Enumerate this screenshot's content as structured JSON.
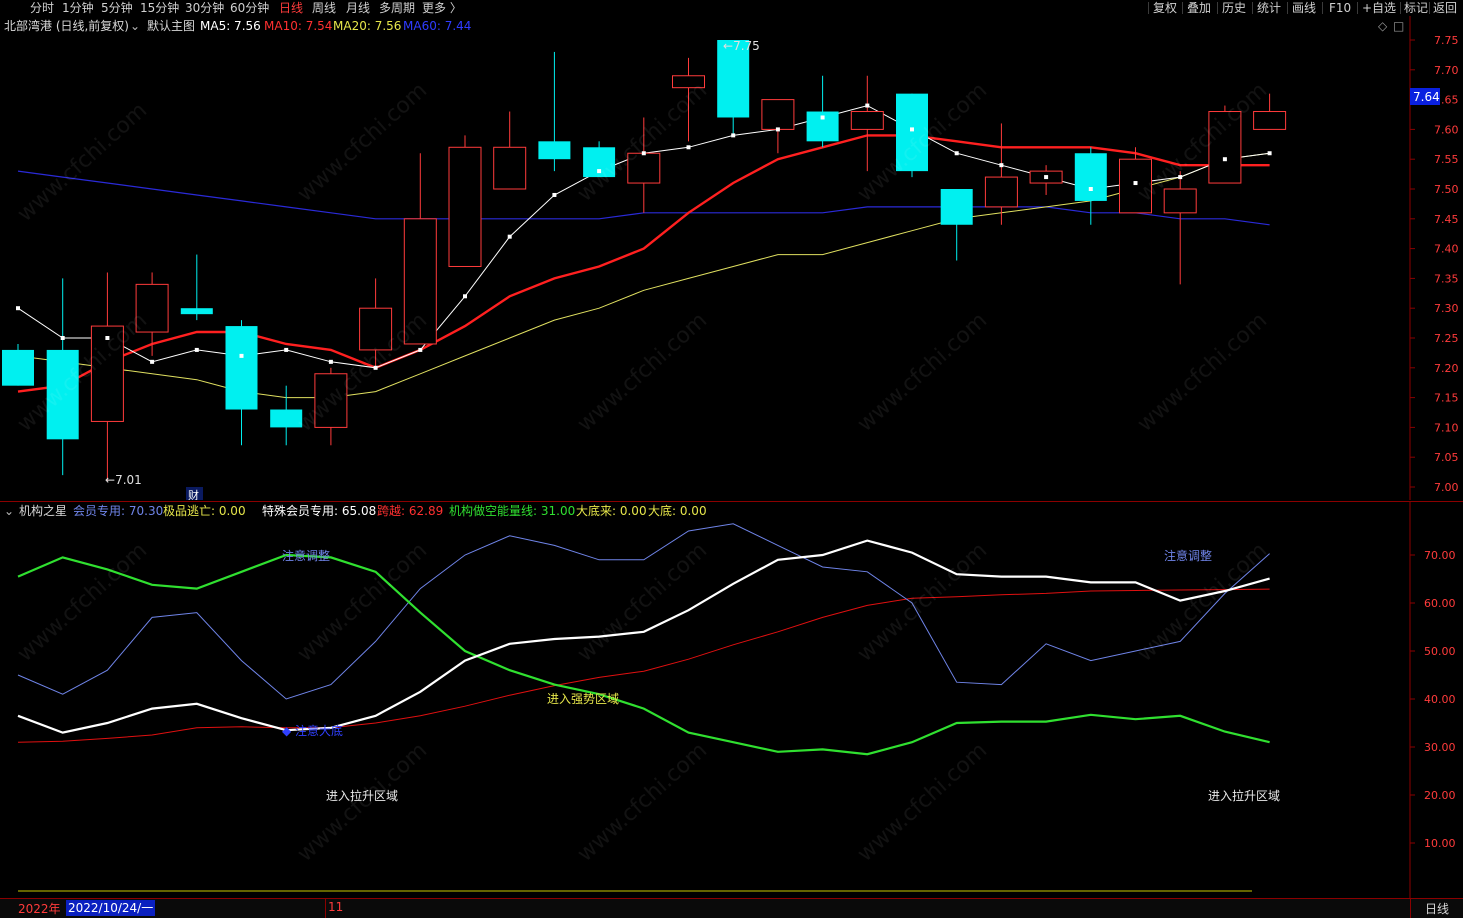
{
  "toolbar": {
    "periods": [
      "分时",
      "1分钟",
      "5分钟",
      "15分钟",
      "30分钟",
      "60分钟",
      "日线",
      "周线",
      "月线",
      "多周期",
      "更多 〉"
    ],
    "active_period": "日线",
    "right_buttons": [
      "复权",
      "叠加",
      "历史",
      "统计",
      "画线",
      "F10",
      "+自选",
      "返回"
    ]
  },
  "main_header": {
    "stock": "北部湾港 (日线,前复权)",
    "template": "默认主图",
    "ma5": "MA5: 7.56",
    "ma10": "MA10: 7.54",
    "ma20": "MA20: 7.56",
    "ma60": "MA60: 7.44"
  },
  "main_axis": {
    "ticks": [
      "7.75",
      "7.70",
      "7.65",
      "7.60",
      "7.55",
      "7.50",
      "7.45",
      "7.40",
      "7.35",
      "7.30",
      "7.25",
      "7.20",
      "7.15",
      "7.10",
      "7.05",
      "7.00"
    ],
    "current_price": "7.64",
    "high_label": "7.75",
    "low_label": "7.01",
    "finance_badge": "财"
  },
  "indicator_header": {
    "name": "机构之星",
    "member": "会员专用: 70.30",
    "escape": "极品逃亡: 0.00",
    "special": "特殊会员专用: 65.08",
    "cross": "跨越: 62.89",
    "energy": "机构做空能量线: 31.00",
    "bottom_come": "大底来: 0.00",
    "bottom": "大底: 0.00"
  },
  "indicator_axis": {
    "ticks": [
      "70.00",
      "60.00",
      "50.00",
      "40.00",
      "30.00",
      "20.00",
      "10.00"
    ]
  },
  "annotations": {
    "attention_1": "注意调整",
    "attention_2": "注意调整",
    "strong_zone": "进入强势区域",
    "raise_zone_1": "进入拉升区域",
    "raise_zone_2": "进入拉升区域",
    "bottom_mark": "◆ 注意大底"
  },
  "bottom_bar": {
    "year": "2022年",
    "date": "2022/10/24/一",
    "month": "11",
    "period": "日线"
  },
  "watermark": "www.cfchi.com",
  "colors": {
    "up": "#ff3b3b",
    "down": "#00f0f0",
    "ma5": "#ffffff",
    "ma10": "#ff2020",
    "ma20": "#e0e060",
    "ma60": "#2a2ad8",
    "green": "#30e030",
    "blue_line": "#6f84e8"
  },
  "chart_data": {
    "type": "candlestick",
    "title": "北部湾港 (日线,前复权)",
    "ylim": [
      6.99,
      7.77
    ],
    "candles": [
      {
        "o": 7.23,
        "h": 7.24,
        "l": 7.17,
        "c": 7.17
      },
      {
        "o": 7.23,
        "h": 7.35,
        "l": 7.02,
        "c": 7.08
      },
      {
        "o": 7.11,
        "h": 7.36,
        "l": 7.01,
        "c": 7.27
      },
      {
        "o": 7.26,
        "h": 7.36,
        "l": 7.22,
        "c": 7.34
      },
      {
        "o": 7.3,
        "h": 7.39,
        "l": 7.28,
        "c": 7.29
      },
      {
        "o": 7.27,
        "h": 7.28,
        "l": 7.07,
        "c": 7.13
      },
      {
        "o": 7.13,
        "h": 7.17,
        "l": 7.07,
        "c": 7.1
      },
      {
        "o": 7.1,
        "h": 7.2,
        "l": 7.07,
        "c": 7.19
      },
      {
        "o": 7.23,
        "h": 7.35,
        "l": 7.2,
        "c": 7.3
      },
      {
        "o": 7.24,
        "h": 7.56,
        "l": 7.24,
        "c": 7.45
      },
      {
        "o": 7.37,
        "h": 7.59,
        "l": 7.37,
        "c": 7.57
      },
      {
        "o": 7.5,
        "h": 7.63,
        "l": 7.5,
        "c": 7.57
      },
      {
        "o": 7.58,
        "h": 7.73,
        "l": 7.53,
        "c": 7.55
      },
      {
        "o": 7.57,
        "h": 7.58,
        "l": 7.53,
        "c": 7.52
      },
      {
        "o": 7.51,
        "h": 7.62,
        "l": 7.46,
        "c": 7.56
      },
      {
        "o": 7.67,
        "h": 7.72,
        "l": 7.58,
        "c": 7.69
      },
      {
        "o": 7.75,
        "h": 7.75,
        "l": 7.59,
        "c": 7.62
      },
      {
        "o": 7.6,
        "h": 7.65,
        "l": 7.56,
        "c": 7.65
      },
      {
        "o": 7.63,
        "h": 7.69,
        "l": 7.57,
        "c": 7.58
      },
      {
        "o": 7.6,
        "h": 7.69,
        "l": 7.53,
        "c": 7.63
      },
      {
        "o": 7.66,
        "h": 7.66,
        "l": 7.52,
        "c": 7.53
      },
      {
        "o": 7.5,
        "h": 7.5,
        "l": 7.38,
        "c": 7.44
      },
      {
        "o": 7.47,
        "h": 7.61,
        "l": 7.44,
        "c": 7.52
      },
      {
        "o": 7.51,
        "h": 7.54,
        "l": 7.49,
        "c": 7.53
      },
      {
        "o": 7.56,
        "h": 7.57,
        "l": 7.44,
        "c": 7.48
      },
      {
        "o": 7.46,
        "h": 7.57,
        "l": 7.46,
        "c": 7.55
      },
      {
        "o": 7.46,
        "h": 7.53,
        "l": 7.34,
        "c": 7.5
      },
      {
        "o": 7.51,
        "h": 7.64,
        "l": 7.51,
        "c": 7.63
      },
      {
        "o": 7.6,
        "h": 7.66,
        "l": 7.6,
        "c": 7.63
      }
    ],
    "series": [
      {
        "name": "MA5",
        "values": [
          7.3,
          7.25,
          7.25,
          7.21,
          7.23,
          7.22,
          7.23,
          7.21,
          7.2,
          7.23,
          7.32,
          7.42,
          7.49,
          7.53,
          7.56,
          7.57,
          7.59,
          7.6,
          7.62,
          7.64,
          7.6,
          7.56,
          7.54,
          7.52,
          7.5,
          7.51,
          7.52,
          7.55,
          7.56
        ]
      },
      {
        "name": "MA10",
        "values": [
          7.16,
          7.17,
          7.21,
          7.24,
          7.26,
          7.26,
          7.24,
          7.23,
          7.2,
          7.23,
          7.27,
          7.32,
          7.35,
          7.37,
          7.4,
          7.46,
          7.51,
          7.55,
          7.57,
          7.59,
          7.59,
          7.58,
          7.57,
          7.57,
          7.57,
          7.56,
          7.54,
          7.54,
          7.54
        ]
      },
      {
        "name": "MA20",
        "values": [
          7.22,
          7.21,
          7.2,
          7.19,
          7.18,
          7.16,
          7.15,
          7.15,
          7.16,
          7.19,
          7.22,
          7.25,
          7.28,
          7.3,
          7.33,
          7.35,
          7.37,
          7.39,
          7.39,
          7.41,
          7.43,
          7.45,
          7.46,
          7.47,
          7.48,
          7.5,
          7.52,
          7.55,
          7.56
        ]
      },
      {
        "name": "MA60",
        "values": [
          7.53,
          7.52,
          7.51,
          7.5,
          7.49,
          7.48,
          7.47,
          7.46,
          7.45,
          7.45,
          7.45,
          7.45,
          7.45,
          7.45,
          7.46,
          7.46,
          7.46,
          7.46,
          7.46,
          7.47,
          7.47,
          7.47,
          7.47,
          7.47,
          7.46,
          7.46,
          7.45,
          7.45,
          7.44
        ]
      }
    ],
    "indicator": {
      "ylim": [
        0,
        80
      ],
      "series": [
        {
          "name": "机构做空能量线",
          "values": [
            65.5,
            69.5,
            67,
            63.8,
            63,
            66.5,
            70,
            69.5,
            66.5,
            58,
            50,
            46,
            43,
            41,
            38,
            33,
            31,
            29,
            29.5,
            28.5,
            31,
            35,
            35.3,
            35.3,
            36.7,
            35.8,
            36.5,
            33.2,
            31
          ]
        },
        {
          "name": "特殊会员专用",
          "values": [
            36.5,
            33,
            35,
            38,
            39,
            36,
            33.5,
            34,
            36.5,
            41.5,
            48,
            51.5,
            52.5,
            53,
            54,
            58.5,
            64,
            69,
            70,
            73,
            70.5,
            66,
            65.5,
            65.5,
            64.3,
            64.3,
            60.5,
            62.5,
            65.08
          ]
        },
        {
          "name": "会员专用",
          "values": [
            45,
            41,
            46,
            57,
            58,
            48,
            40,
            43,
            52,
            63,
            70,
            74,
            72,
            69,
            69,
            75,
            76.5,
            72,
            67.5,
            66.5,
            60,
            43.5,
            43,
            51.5,
            48,
            50,
            52,
            62,
            70.3
          ]
        },
        {
          "name": "跨越",
          "values": [
            31,
            31.2,
            31.8,
            32.5,
            34,
            34.2,
            34,
            34,
            35,
            36.5,
            38.5,
            40.8,
            42.8,
            44.5,
            45.8,
            48.3,
            51.3,
            54,
            57,
            59.5,
            61,
            61.3,
            61.7,
            62,
            62.5,
            62.6,
            62.7,
            62.8,
            62.89
          ]
        }
      ]
    }
  }
}
